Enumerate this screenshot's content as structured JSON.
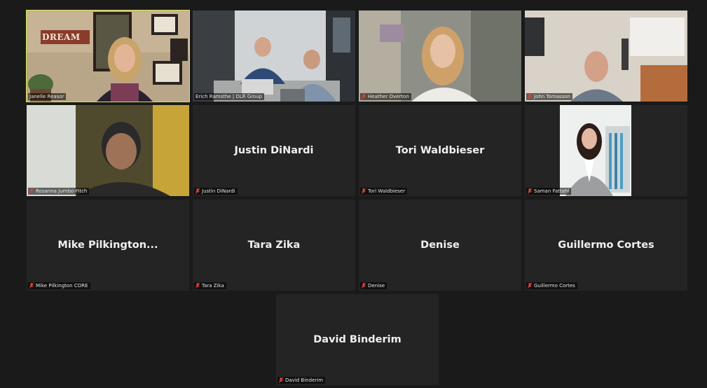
{
  "participants": [
    {
      "display": "",
      "tag": "Janelle Reasor",
      "video": true,
      "muted": false
    },
    {
      "display": "",
      "tag": "Erich Ramsthe | DLR Group",
      "video": true,
      "muted": false
    },
    {
      "display": "",
      "tag": "Heather Overton",
      "video": true,
      "muted": true
    },
    {
      "display": "",
      "tag": "John Tomasson",
      "video": true,
      "muted": true
    },
    {
      "display": "",
      "tag": "Rosanna Jumbo-Fitch",
      "video": true,
      "muted": true
    },
    {
      "display": "Justin DiNardi",
      "tag": "Justin DiNardi",
      "video": false,
      "muted": true
    },
    {
      "display": "Tori Waldbieser",
      "tag": "Tori Waldbieser",
      "video": false,
      "muted": true
    },
    {
      "display": "",
      "tag": "Saman Fattahi",
      "video": true,
      "muted": true
    },
    {
      "display": "Mike  Pilkington...",
      "tag": "Mike Pilkington CORE",
      "video": false,
      "muted": true
    },
    {
      "display": "Tara Zika",
      "tag": "Tara Zika",
      "video": false,
      "muted": true
    },
    {
      "display": "Denise",
      "tag": "Denise",
      "video": false,
      "muted": true
    },
    {
      "display": "Guillermo Cortes",
      "tag": "Guillermo Cortes",
      "video": false,
      "muted": true
    },
    {
      "display": "David Binderim",
      "tag": "David Binderim",
      "video": false,
      "muted": true
    }
  ],
  "scene_text": {
    "dream_sign": "DREAM"
  },
  "colors": {
    "speaker_outline": "#d8e84a",
    "mute_icon": "#e0403a",
    "tile_bg": "#242424"
  }
}
